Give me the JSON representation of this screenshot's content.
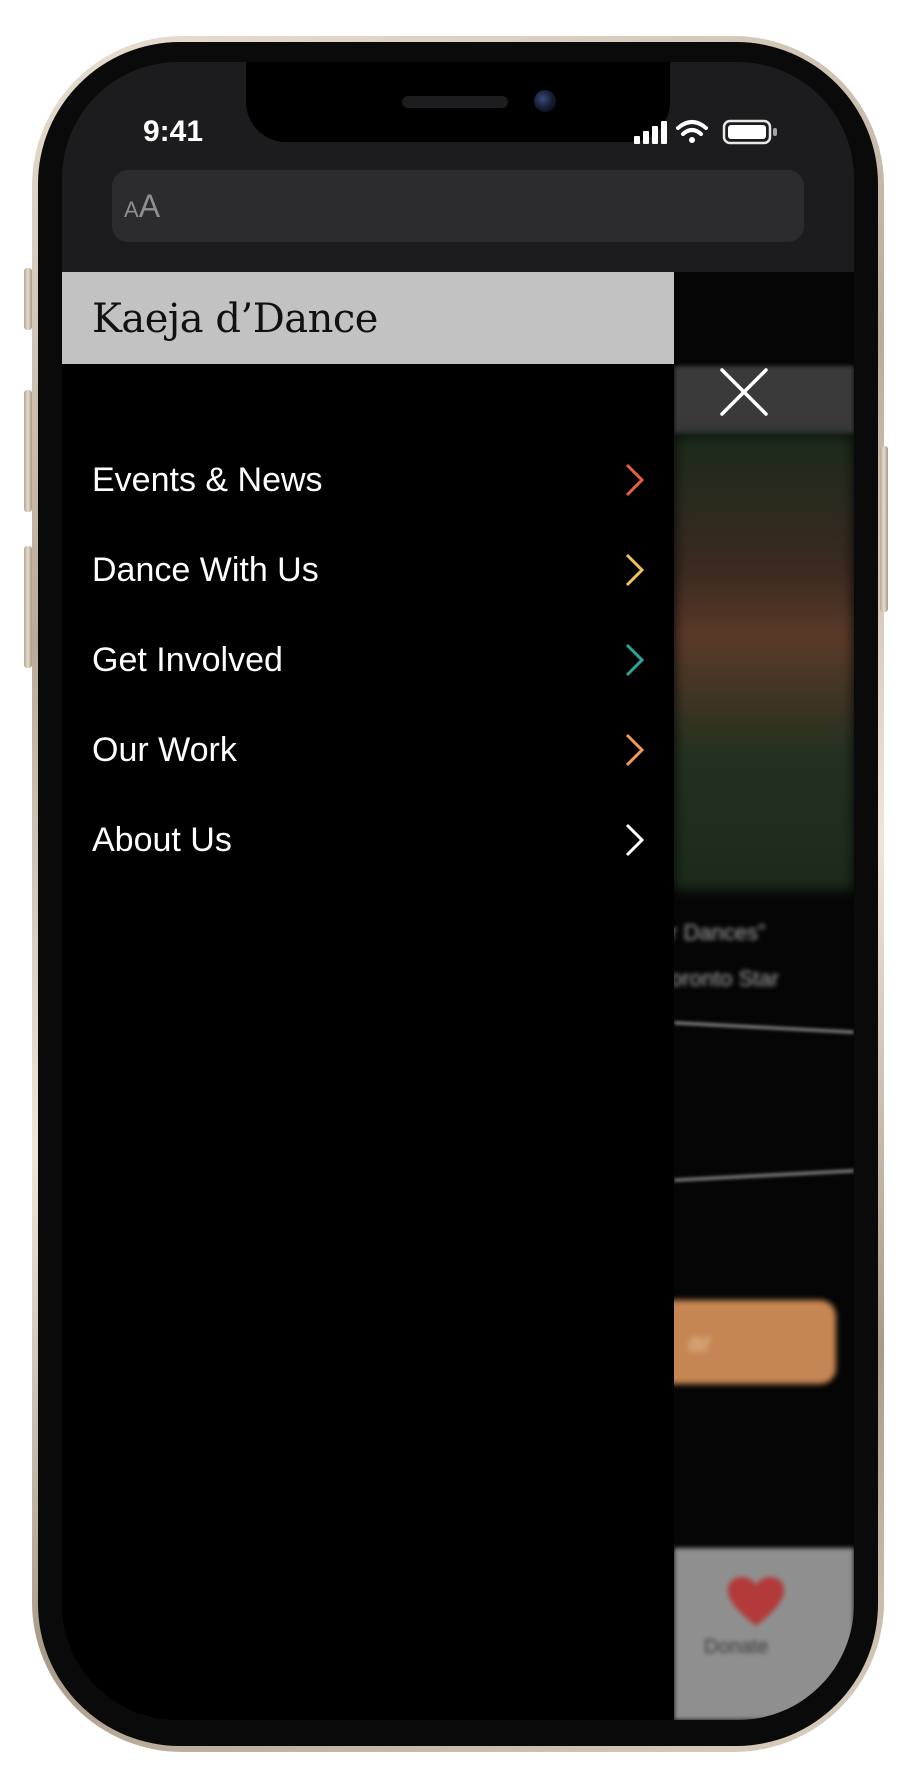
{
  "status_bar": {
    "time": "9:41"
  },
  "browser": {
    "text_size_label_small": "A",
    "text_size_label_large": "A"
  },
  "drawer": {
    "brand": "Kaeja d’Dance",
    "close_icon": "close-icon",
    "items": [
      {
        "label": "Events & News",
        "chevron_color": "#e5603d"
      },
      {
        "label": "Dance With Us",
        "chevron_color": "#f1c15a"
      },
      {
        "label": "Get Involved",
        "chevron_color": "#2ba597"
      },
      {
        "label": "Our Work",
        "chevron_color": "#f39a52"
      },
      {
        "label": "About Us",
        "chevron_color": "#ffffff"
      }
    ]
  },
  "background_page": {
    "quote_line_1": "r Dances”",
    "quote_line_2": "oronto Star",
    "button_label": "ar",
    "footer_label": "Donate",
    "accent_color": "#c58653"
  }
}
